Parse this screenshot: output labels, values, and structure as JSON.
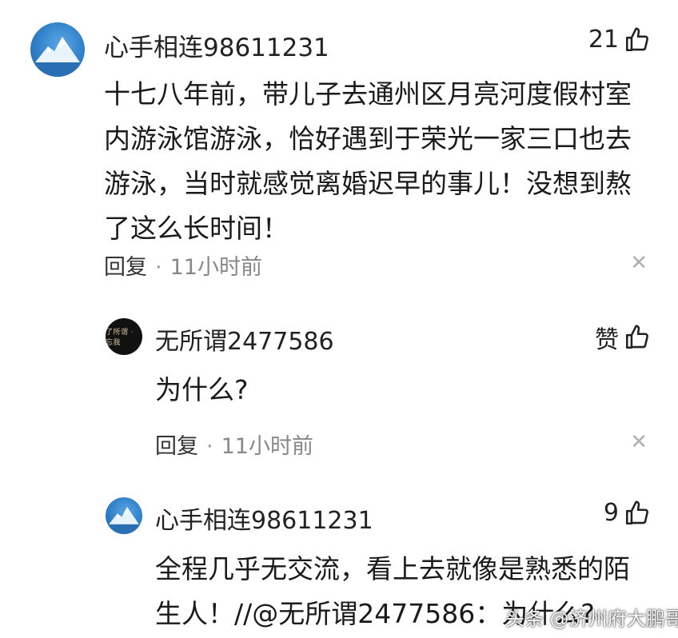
{
  "comments": [
    {
      "username": "心手相连98611231",
      "like_count": "21",
      "content": "十七八年前，带儿子去通州区月亮河度假村室内游泳馆游泳，恰好遇到于荣光一家三口也去游泳，当时就感觉离婚迟早的事儿！没想到熬了这么长时间！",
      "reply_label": "回复",
      "separator": "·",
      "time": "11小时前"
    }
  ],
  "replies": [
    {
      "username": "无所谓2477586",
      "avatar_text": "了所谓 · 忘我",
      "like_label": "赞",
      "content": "为什么?",
      "reply_label": "回复",
      "separator": "·",
      "time": "11小时前"
    },
    {
      "username": "心手相连98611231",
      "like_count": "9",
      "content": "全程几乎无交流，看上去就像是熟悉的陌生人！//@无所谓2477586：为什么?"
    }
  ],
  "close_symbol": "✕",
  "watermark": "头条 @济州府大鹏哥",
  "icons": [
    "thumbs-up-icon",
    "close-icon",
    "avatar-mountain-icon"
  ]
}
